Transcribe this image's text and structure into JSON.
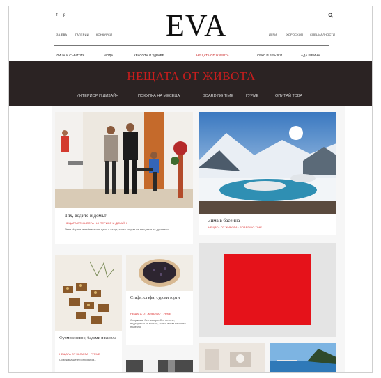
{
  "header": {
    "logo": "EVA",
    "social": [
      "f",
      "p"
    ],
    "search_icon": "search-icon",
    "left_links": [
      "ЗА ЕВА",
      "ГАЛЕРИИ",
      "КОНКУРСИ"
    ],
    "right_links": [
      "ИГРИ",
      "ХОРОСКОП",
      "СПЕЦИАЛНОСТИ"
    ]
  },
  "main_nav": [
    "ЛИЦА И СЪБИТИЯ",
    "МОДА",
    "КРАСОТА И ЗДРАВЕ",
    "НЕЩАТА ОТ ЖИВОТА",
    "СЕКС И ВРЪЗКИ",
    "АДА И ВИНА"
  ],
  "banner": {
    "title": "НЕЩАТА ОТ ЖИВОТА",
    "subnav": [
      "ИНТЕРИОР И ДИЗАЙН",
      "ПОКУПКА НА МЕСЕЦА",
      "BOARDING TIME",
      "ГУРМЕ",
      "ОПИТАЙ ТОВА"
    ]
  },
  "cards": {
    "home": {
      "title": "Тях, водите и домът",
      "category": "НЕЩАТА ОТ ЖИВОТА · ИНТЕРИОР И ДИЗАЙН",
      "text": "Рена Нарлет и нейният син едно и същи, които гледат на нещата и на думите си."
    },
    "spa": {
      "title": "Зима в басейна",
      "category": "НЕЩАТА ОТ ЖИВОТА · BOARDING TIME"
    },
    "fig": {
      "title": "Фурми с кокос, бадеми и канела",
      "category": "НЕЩАТА ОТ ЖИВОТА · ГУРМЕ",
      "text": "Освежаващите бонбони за..."
    },
    "cake": {
      "title": "Стафи, стафи, сурови торти",
      "category": "НЕЩАТА ОТ ЖИВОТА · ГУРМЕ",
      "text": "Сладкиши без захар и без печене, подходящи за всички, които искат нещо по-полезно."
    }
  },
  "colors": {
    "accent": "#c81d1d",
    "banner_bg": "#2b2323",
    "ad_red": "#e5121a",
    "ad_bg": "#e4e4e4"
  }
}
